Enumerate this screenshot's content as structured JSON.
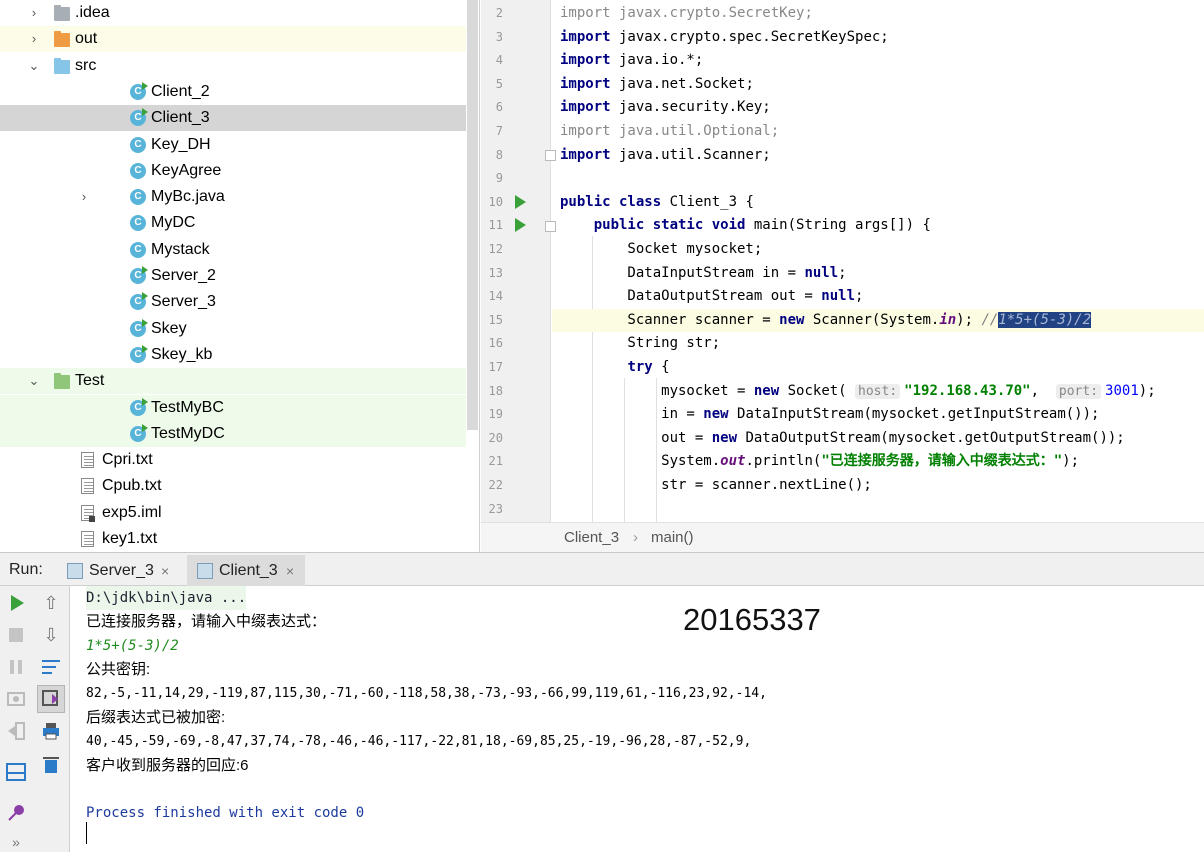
{
  "tree": {
    "items": [
      {
        "label": ".idea",
        "type": "folder",
        "color": "gray",
        "level": 0,
        "arrow": "›",
        "state": ""
      },
      {
        "label": "out",
        "type": "folder",
        "color": "orange",
        "level": 0,
        "arrow": "›",
        "state": "excl"
      },
      {
        "label": "src",
        "type": "folder",
        "color": "blue",
        "level": 0,
        "arrow": "⌄",
        "state": ""
      },
      {
        "label": "Client_2",
        "type": "class-run",
        "level": 2,
        "arrow": "",
        "state": ""
      },
      {
        "label": "Client_3",
        "type": "class-run",
        "level": 2,
        "arrow": "",
        "state": "sel"
      },
      {
        "label": "Key_DH",
        "type": "class",
        "level": 2,
        "arrow": "",
        "state": ""
      },
      {
        "label": "KeyAgree",
        "type": "class",
        "level": 2,
        "arrow": "",
        "state": ""
      },
      {
        "label": "MyBc.java",
        "type": "class",
        "level": 2,
        "arrow": "›",
        "state": ""
      },
      {
        "label": "MyDC",
        "type": "class",
        "level": 2,
        "arrow": "",
        "state": ""
      },
      {
        "label": "Mystack",
        "type": "class",
        "level": 2,
        "arrow": "",
        "state": ""
      },
      {
        "label": "Server_2",
        "type": "class-run",
        "level": 2,
        "arrow": "",
        "state": ""
      },
      {
        "label": "Server_3",
        "type": "class-run",
        "level": 2,
        "arrow": "",
        "state": ""
      },
      {
        "label": "Skey",
        "type": "class-run",
        "level": 2,
        "arrow": "",
        "state": ""
      },
      {
        "label": "Skey_kb",
        "type": "class-run",
        "level": 2,
        "arrow": "",
        "state": ""
      },
      {
        "label": "Test",
        "type": "folder",
        "color": "green",
        "level": 0,
        "arrow": "⌄",
        "state": "test"
      },
      {
        "label": "TestMyBC",
        "type": "class-run",
        "level": 2,
        "arrow": "",
        "state": "test"
      },
      {
        "label": "TestMyDC",
        "type": "class-run",
        "level": 2,
        "arrow": "",
        "state": "test"
      },
      {
        "label": "Cpri.txt",
        "type": "file",
        "level": 1,
        "arrow": "",
        "state": ""
      },
      {
        "label": "Cpub.txt",
        "type": "file",
        "level": 1,
        "arrow": "",
        "state": ""
      },
      {
        "label": "exp5.iml",
        "type": "iml",
        "level": 1,
        "arrow": "",
        "state": ""
      },
      {
        "label": "key1.txt",
        "type": "file",
        "level": 1,
        "arrow": "",
        "state": ""
      }
    ]
  },
  "editor": {
    "line_numbers": [
      "2",
      "3",
      "4",
      "5",
      "6",
      "7",
      "8",
      "9",
      "10",
      "11",
      "12",
      "13",
      "14",
      "15",
      "16",
      "17",
      "18",
      "19",
      "20",
      "21",
      "22",
      "23"
    ],
    "lines": {
      "l2a": "import",
      "l2b": " javax.crypto.SecretKey;",
      "l3a": "import",
      "l3b": " javax.crypto.spec.SecretKeySpec;",
      "l4a": "import",
      "l4b": " java.io.*;",
      "l5a": "import",
      "l5b": " java.net.Socket;",
      "l6a": "import",
      "l6b": " java.security.Key;",
      "l7a": "import",
      "l7b": " java.util.Optional;",
      "l8a": "import",
      "l8b": " java.util.Scanner;",
      "l10a": "public class",
      "l10b": " Client_3 {",
      "l11i": "    ",
      "l11a": "public static void",
      "l11b": " main(String args[]) {",
      "l12": "        Socket mysocket;",
      "l13a": "        DataInputStream in = ",
      "l13b": "null",
      "l13c": ";",
      "l14a": "        DataOutputStream out = ",
      "l14b": "null",
      "l14c": ";",
      "l15a": "        Scanner scanner = ",
      "l15b": "new",
      "l15c": " Scanner(System.",
      "l15d": "in",
      "l15e": "); ",
      "l15f": "//",
      "l15g": "1*5+(5-3)/2",
      "l16": "        String str;",
      "l17i": "        ",
      "l17a": "try",
      "l17b": " {",
      "l18a": "            mysocket = ",
      "l18b": "new",
      "l18c": " Socket( ",
      "l18h1": "host:",
      "l18d": "\"192.168.43.70\"",
      "l18e": ",  ",
      "l18h2": "port:",
      "l18f": "3001",
      "l18g": ");",
      "l19a": "            in = ",
      "l19b": "new",
      "l19c": " DataInputStream(mysocket.getInputStream());",
      "l20a": "            out = ",
      "l20b": "new",
      "l20c": " DataOutputStream(mysocket.getOutputStream());",
      "l21a": "            System.",
      "l21b": "out",
      "l21c": ".println(",
      "l21d": "\"已连接服务器，请输入中缀表达式：\"",
      "l21e": ");",
      "l22": "            str = scanner.nextLine();"
    },
    "breadcrumb": {
      "class": "Client_3",
      "sep": "›",
      "method": "main()"
    }
  },
  "run": {
    "label": "Run:",
    "tabs": [
      {
        "label": "Server_3",
        "close": "×"
      },
      {
        "label": "Client_3",
        "close": "×"
      }
    ],
    "output": [
      "D:\\jdk\\bin\\java ...",
      "已连接服务器，请输入中缀表达式：",
      "1*5+(5-3)/2",
      "公共密钥:",
      "82,-5,-11,14,29,-119,87,115,30,-71,-60,-118,58,38,-73,-93,-66,99,119,61,-116,23,92,-14,",
      "后缀表达式已被加密:",
      "40,-45,-59,-69,-8,47,37,74,-78,-46,-46,-117,-22,81,18,-69,85,25,-19,-96,28,-87,-52,9,",
      "客户收到服务器的回应:6",
      "Process finished with exit code 0"
    ],
    "stamp": "20165337",
    "toolbar_icons": [
      "rerun-icon",
      "scroll-up-icon",
      "stop-icon",
      "scroll-down-icon",
      "pause-icon",
      "soft-wrap-icon",
      "dump-threads-icon",
      "scroll-to-end-icon",
      "exit-icon",
      "print-icon",
      "layout-icon",
      "trash-icon",
      "pin-icon",
      "more-icon"
    ]
  },
  "colors": {
    "selection": "#d5d5d5",
    "accent_green": "#3aa03a",
    "keyword": "#000080",
    "string": "#008000"
  }
}
